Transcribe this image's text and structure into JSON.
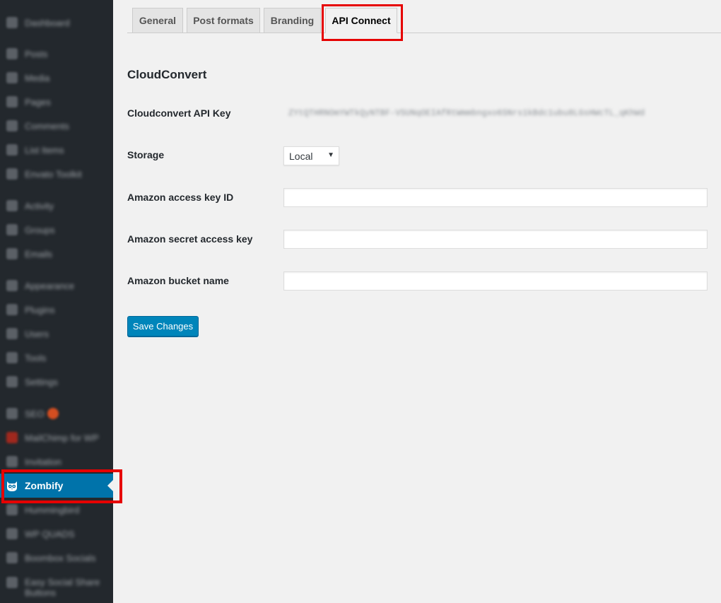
{
  "sidebar": {
    "items": [
      {
        "label": "Dashboard"
      },
      {
        "label": "Posts"
      },
      {
        "label": "Media"
      },
      {
        "label": "Pages"
      },
      {
        "label": "Comments"
      },
      {
        "label": "List Items"
      },
      {
        "label": "Envato Toolkit"
      },
      {
        "label": "Activity"
      },
      {
        "label": "Groups"
      },
      {
        "label": "Emails"
      },
      {
        "label": "Appearance"
      },
      {
        "label": "Plugins"
      },
      {
        "label": "Users"
      },
      {
        "label": "Tools"
      },
      {
        "label": "Settings"
      },
      {
        "label": "SEO"
      },
      {
        "label": "MailChimp for WP"
      },
      {
        "label": "Invitation"
      },
      {
        "label": "Hummingbird"
      },
      {
        "label": "WP QUADS"
      },
      {
        "label": "Boombox Socials"
      },
      {
        "label": "Easy Social Share Buttons"
      }
    ],
    "active_item": {
      "label": "Zombify",
      "icon": "zombify-owl-icon"
    },
    "highlight_color": "#e60000",
    "active_color": "#0073aa"
  },
  "tabs": [
    {
      "label": "General"
    },
    {
      "label": "Post formats"
    },
    {
      "label": "Branding"
    },
    {
      "label": "API Connect"
    }
  ],
  "form": {
    "section_title": "CloudConvert",
    "api_key": {
      "label": "Cloudconvert API Key",
      "value": "ZYtQTHRNOmYWTkQyNTBF-VSUNqOEIAfRtWmmbngxo6SNrs1kBdc1ubu8LGsHWcTL_qKhWd"
    },
    "storage": {
      "label": "Storage",
      "value": "Local"
    },
    "amazon_key_id": {
      "label": "Amazon access key ID",
      "value": ""
    },
    "amazon_secret": {
      "label": "Amazon secret access key",
      "value": ""
    },
    "amazon_bucket": {
      "label": "Amazon bucket name",
      "value": ""
    },
    "save_label": "Save Changes"
  }
}
